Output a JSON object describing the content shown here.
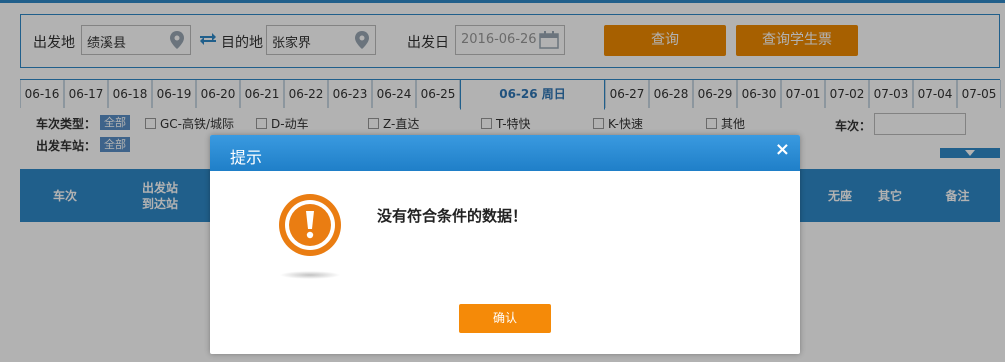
{
  "search": {
    "from_label": "出发地",
    "from_value": "绩溪县",
    "to_label": "目的地",
    "to_value": "张家界",
    "date_label": "出发日",
    "date_value": "2016-06-26",
    "query_button": "查询",
    "student_button": "查询学生票"
  },
  "dates": [
    "06-16",
    "06-17",
    "06-18",
    "06-19",
    "06-20",
    "06-21",
    "06-22",
    "06-23",
    "06-24",
    "06-25",
    "06-26 周日",
    "06-27",
    "06-28",
    "06-29",
    "06-30",
    "07-01",
    "07-02",
    "07-03",
    "07-04",
    "07-05"
  ],
  "filters": {
    "train_type_label": "车次类型：",
    "all_chip": "全部",
    "types": [
      "GC-高铁/城际",
      "D-动车",
      "Z-直达",
      "T-特快",
      "K-快速",
      "其他"
    ],
    "train_no_label": "车次：",
    "station_label": "出发车站：",
    "station_all_chip": "全部"
  },
  "results_header": {
    "train": "车次",
    "depart_station": "出发站",
    "arrive_station": "到达站",
    "no_seat": "无座",
    "other": "其它",
    "remark": "备注"
  },
  "modal": {
    "title": "提示",
    "close": "×",
    "message": "没有符合条件的数据！",
    "ok_button": "确认"
  },
  "colors": {
    "brand_blue": "#2f88c8",
    "orange": "#f08a00"
  }
}
